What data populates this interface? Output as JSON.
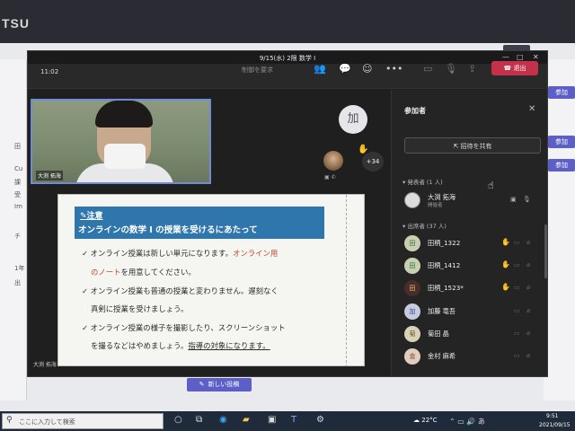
{
  "background": {
    "brand": "TSU",
    "left_items": [
      "田",
      "Cu",
      "課",
      "受",
      "Im",
      "チ",
      "1年",
      "出"
    ],
    "right_buttons": [
      "参加",
      "参加",
      "参加"
    ],
    "new_post_label": "新しい投稿"
  },
  "window": {
    "title": "9/15(水) 2限 数学 I"
  },
  "callbar": {
    "time": "11:02",
    "request_control": "制御を要求",
    "leave_label": "退出"
  },
  "stage": {
    "camera_name": "大渕 拓海",
    "avatar_initial": "加",
    "overflow_count": "+34",
    "slide_footer": "大渕 拓海"
  },
  "slide": {
    "notice": "注意",
    "title": "オンラインの数学 I の授業を受けるにあたって",
    "lines": [
      {
        "pre": "✓ オンライン授業は新しい単元になります。",
        "red": "オンライン用",
        "post": ""
      },
      {
        "pre": "",
        "red": "のノート",
        "post": "を用意してください。"
      },
      {
        "pre": "✓ オンライン授業も普通の授業と変わりません。遅刻なく",
        "red": "",
        "post": ""
      },
      {
        "pre": "真剣に授業を受けましょう。",
        "red": "",
        "post": ""
      },
      {
        "pre": "✓ オンライン授業の様子を撮影したり、スクリーンショット",
        "red": "",
        "post": ""
      },
      {
        "pre": "を撮るなどはやめましょう。",
        "red": "",
        "post": "指導の対象になります。"
      }
    ]
  },
  "panel": {
    "title": "参加者",
    "share_invite": "招待を共有",
    "presenters_header": "発表者 (1 人)",
    "attendees_header": "出席者 (37 人)",
    "presenter": {
      "name": "大渕 拓海",
      "role": "開催者"
    },
    "attendees": [
      {
        "initial": "田",
        "name": "田柄_1322",
        "hand": true
      },
      {
        "initial": "田",
        "name": "田柄_1412",
        "hand": true
      },
      {
        "initial": "田",
        "name": "田柄_1523*",
        "hand": true
      },
      {
        "initial": "加",
        "name": "加藤 竜吾",
        "hand": false
      },
      {
        "initial": "菊",
        "name": "菊田 晶",
        "hand": false
      },
      {
        "initial": "金",
        "name": "金村 麻希",
        "hand": false
      }
    ]
  },
  "taskbar": {
    "search_placeholder": "ここに入力して検索",
    "weather": "22°C",
    "time": "9:51",
    "date": "2021/09/15"
  }
}
